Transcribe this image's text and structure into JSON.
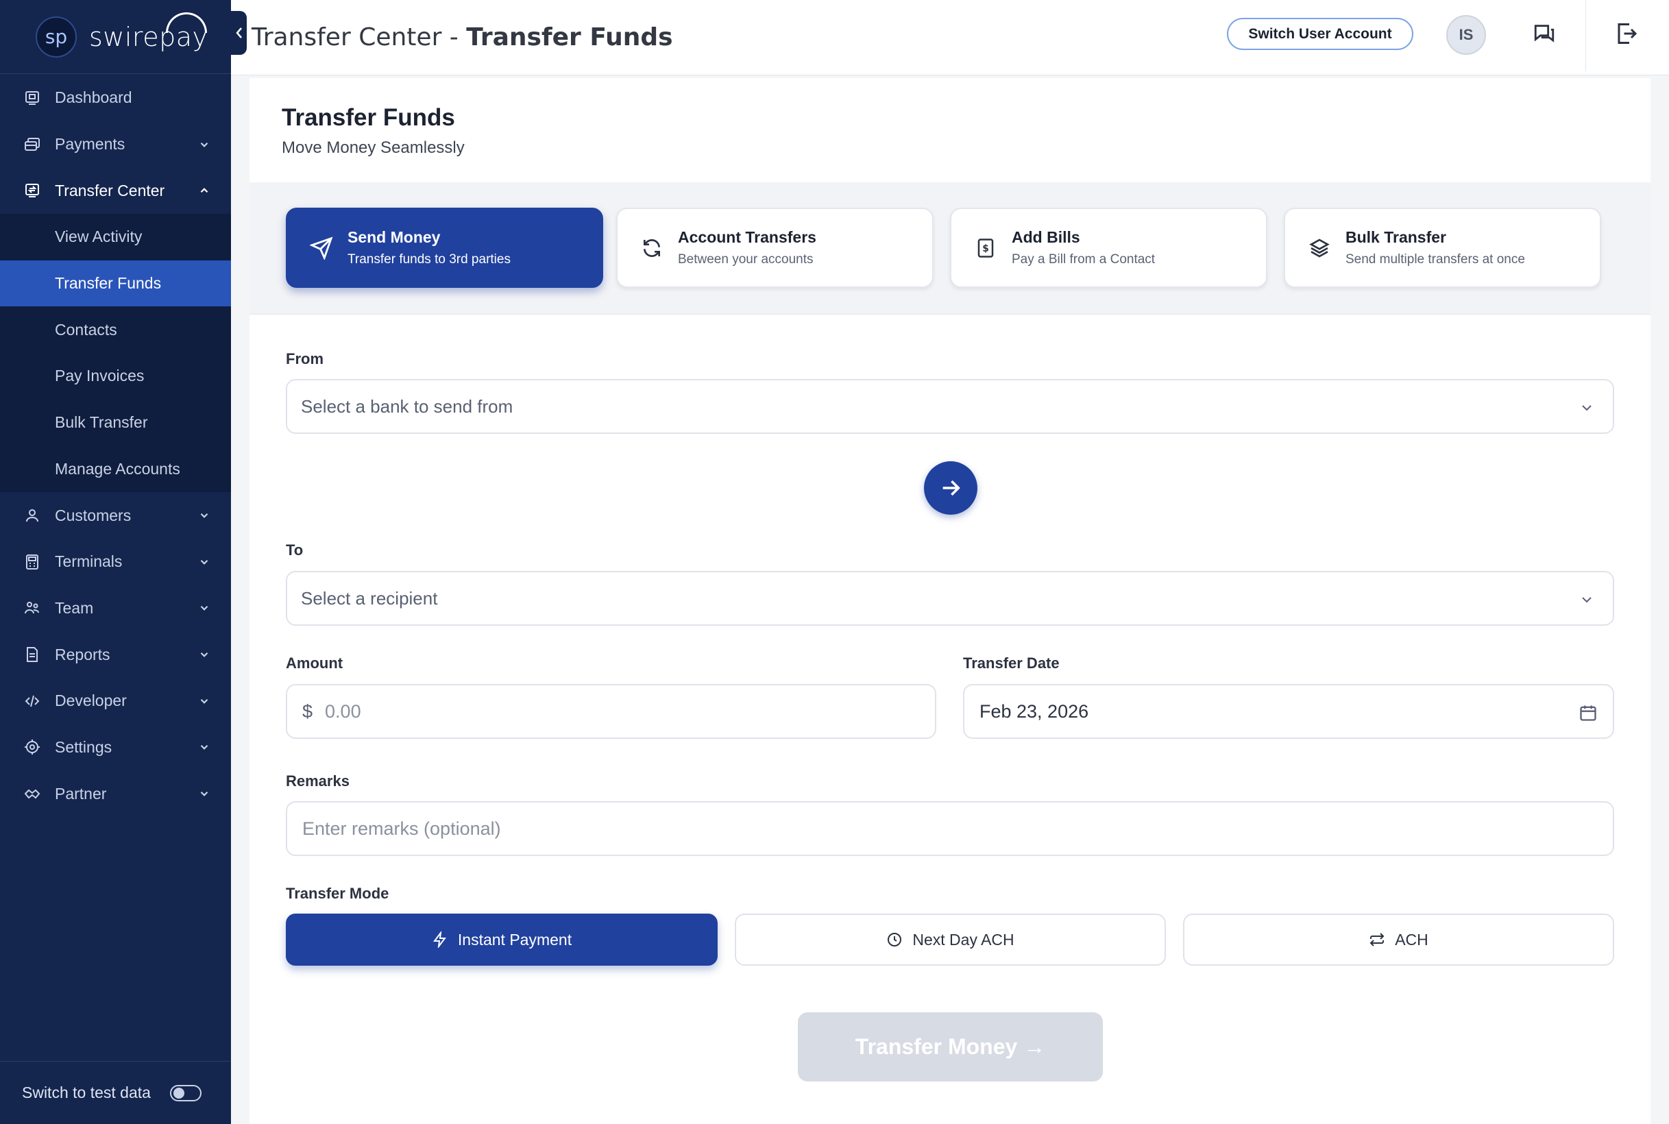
{
  "brand": {
    "mark": "sp",
    "name": "swirepay"
  },
  "sidebar": {
    "items": [
      {
        "label": "Dashboard",
        "icon": "dashboard-icon"
      },
      {
        "label": "Payments",
        "icon": "payments-icon"
      },
      {
        "label": "Transfer Center",
        "icon": "transfer-center-icon"
      },
      {
        "label": "Customers",
        "icon": "customers-icon"
      },
      {
        "label": "Terminals",
        "icon": "terminals-icon"
      },
      {
        "label": "Team",
        "icon": "team-icon"
      },
      {
        "label": "Reports",
        "icon": "reports-icon"
      },
      {
        "label": "Developer",
        "icon": "developer-icon"
      },
      {
        "label": "Settings",
        "icon": "settings-icon"
      },
      {
        "label": "Partner",
        "icon": "partner-icon"
      }
    ],
    "sub_items": [
      "View Activity",
      "Transfer Funds",
      "Contacts",
      "Pay Invoices",
      "Bulk Transfer",
      "Manage Accounts"
    ],
    "footer_label": "Switch to test data"
  },
  "header": {
    "breadcrumb": "Transfer Center - ",
    "title": "Transfer Funds",
    "switch_account": "Switch User Account",
    "avatar_initials": "IS"
  },
  "page": {
    "title": "Transfer Funds",
    "subtitle": "Move Money Seamlessly"
  },
  "tabs": [
    {
      "title": "Send Money",
      "subtitle": "Transfer funds to 3rd parties",
      "icon": "send-icon"
    },
    {
      "title": "Account Transfers",
      "subtitle": "Between your accounts",
      "icon": "refresh-icon"
    },
    {
      "title": "Add Bills",
      "subtitle": "Pay a Bill from a Contact",
      "icon": "bill-icon"
    },
    {
      "title": "Bulk Transfer",
      "subtitle": "Send multiple transfers at once",
      "icon": "layers-icon"
    }
  ],
  "form": {
    "from_label": "From",
    "from_placeholder": "Select a bank to send from",
    "to_label": "To",
    "to_placeholder": "Select a recipient",
    "amount_label": "Amount",
    "currency_symbol": "$",
    "amount_placeholder": "0.00",
    "date_label": "Transfer Date",
    "date_value": "Feb 23, 2026",
    "remarks_label": "Remarks",
    "remarks_placeholder": "Enter remarks (optional)",
    "mode_label": "Transfer Mode",
    "modes": [
      "Instant Payment",
      "Next Day ACH",
      "ACH"
    ],
    "submit_label": "Transfer Money →"
  },
  "colors": {
    "sidebar_bg": "#14254e",
    "accent": "#21419e",
    "active_nav": "#2a55b8",
    "disabled": "#d7dbe3"
  }
}
